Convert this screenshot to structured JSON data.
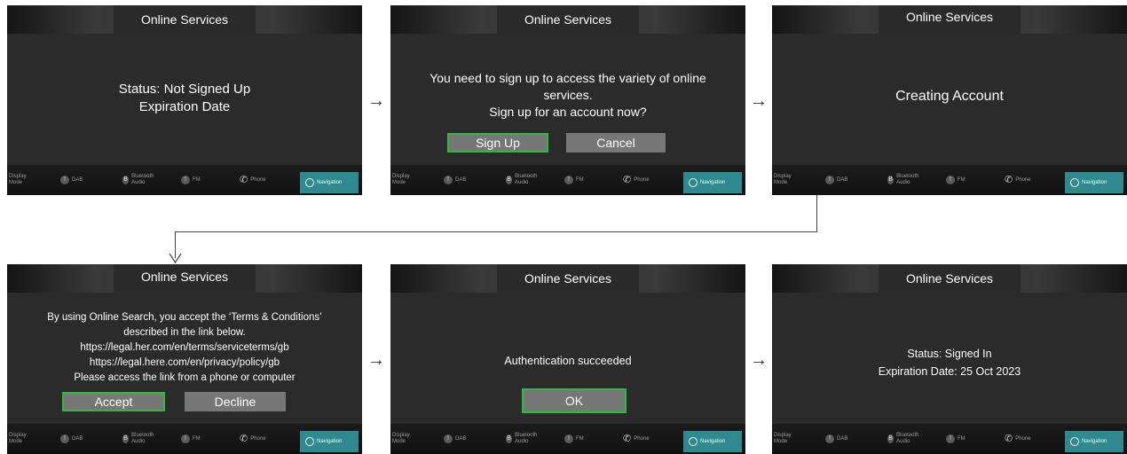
{
  "screens": [
    {
      "title": "Online Services",
      "lines": [
        "Status: Not Signed Up",
        "Expiration Date"
      ],
      "buttons": []
    },
    {
      "title": "Online Services",
      "lines": [
        "You need to sign up to access the variety of online",
        "services.",
        "Sign up for an account now?"
      ],
      "buttons": [
        {
          "label": "Sign Up",
          "primary": true
        },
        {
          "label": "Cancel",
          "primary": false
        }
      ]
    },
    {
      "title": "Online Services",
      "lines": [
        "Creating Account"
      ],
      "buttons": []
    },
    {
      "title": "Online Services",
      "lines": [
        "By using Online Search, you accept the ‘Terms & Conditions’",
        "described in the link below.",
        "https://legal.her.com/en/terms/serviceterms/gb",
        "https://legal.here.com/en/privacy/policy/gb",
        "Please access the link from a phone or computer"
      ],
      "buttons": [
        {
          "label": "Accept",
          "primary": true
        },
        {
          "label": "Decline",
          "primary": false
        }
      ]
    },
    {
      "title": "Online Services",
      "lines": [
        "Authentication succeeded"
      ],
      "buttons": [
        {
          "label": "OK",
          "primary": true
        }
      ]
    },
    {
      "title": "Online Services",
      "lines": [
        "Status: Signed In",
        "Expiration Date:  25 Oct 2023"
      ],
      "buttons": []
    }
  ],
  "bottom_bar": {
    "display_mode": "Display Mode",
    "dab": "DAB",
    "bluetooth_audio": "Bluetooth Audio",
    "fm": "FM",
    "phone": "Phone",
    "navigation": "Navigation"
  },
  "arrow_glyph": "→",
  "colors": {
    "screen_bg": "#2b2b2b",
    "primary_border": "#2dbb3a",
    "button_bg": "#777777",
    "nav_bg": "#2f8a8f"
  }
}
